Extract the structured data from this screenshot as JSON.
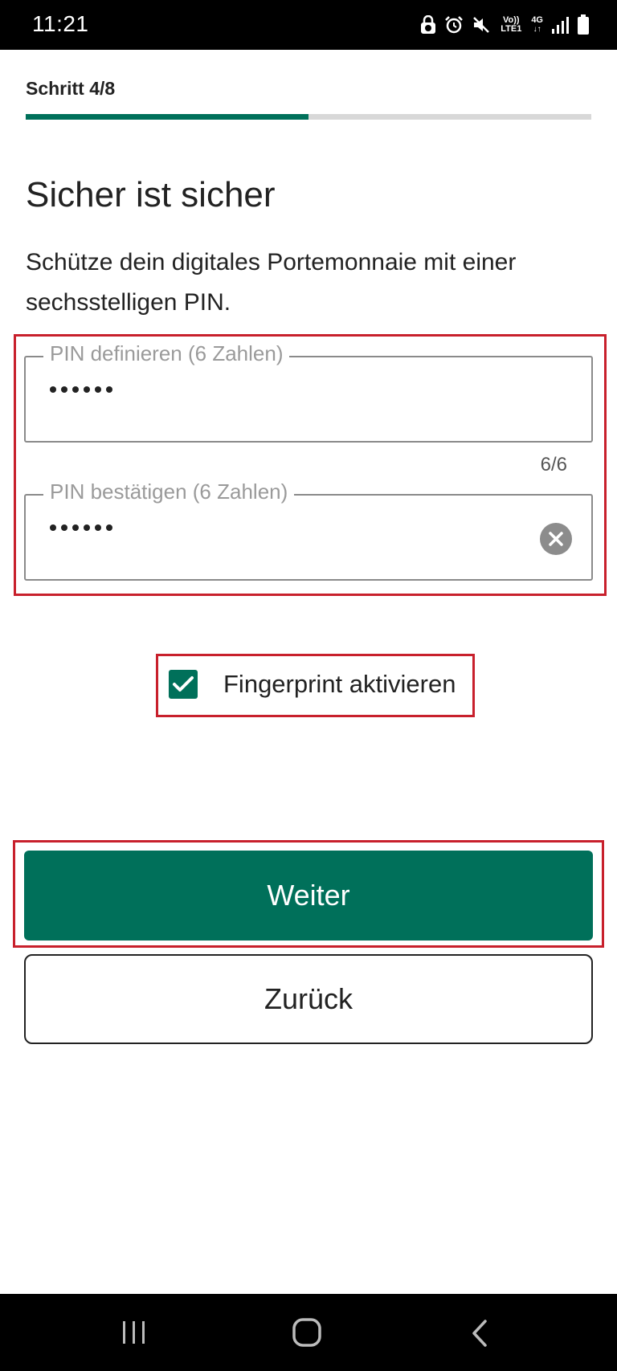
{
  "status_bar": {
    "time": "11:21",
    "network_label": "Vo)) LTE1",
    "network_type": "4G",
    "icons": [
      "lock-clock-icon",
      "alarm-icon",
      "mute-icon",
      "volte-icon",
      "4g-icon",
      "signal-icon",
      "battery-icon"
    ]
  },
  "progress": {
    "step_label": "Schritt 4/8",
    "fraction": 0.5,
    "color": "#00705a"
  },
  "main": {
    "title": "Sicher ist sicher",
    "description": "Schütze dein digitales Portemonnaie mit einer sechsstelligen PIN."
  },
  "pin_define": {
    "label": "PIN definieren (6 Zahlen)",
    "value": "••••••",
    "counter": "6/6"
  },
  "pin_confirm": {
    "label": "PIN bestätigen (6 Zahlen)",
    "value": "••••••",
    "clear_icon": "clear-icon"
  },
  "fingerprint": {
    "label": "Fingerprint aktivieren",
    "checked": true
  },
  "buttons": {
    "next": "Weiter",
    "back": "Zurück"
  },
  "nav_bar": {
    "icons": [
      "recent-apps-icon",
      "home-icon",
      "back-icon"
    ]
  },
  "colors": {
    "accent": "#00705a",
    "highlight": "#c8202c"
  }
}
